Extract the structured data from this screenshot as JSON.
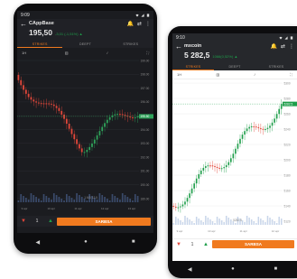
{
  "phones": [
    {
      "id": "left",
      "status_time": "9:09",
      "instrument": "CAppBase",
      "price": "195,50",
      "change": "-3,01 (-1,51%) ▲",
      "tabs": [
        "STRIKES",
        "DEEPT",
        "STRIKES"
      ],
      "toolbar": {
        "interval": "1H",
        "candles_icon": "candles-icon",
        "draw_icon": "pen-icon",
        "fullscreen_icon": "expand-icon"
      },
      "quantity": "1",
      "sell_label": "SARBSA",
      "chart_annotation": "1 MD 12.5",
      "last_price_label": "195.50",
      "axis_labels": [
        "199.00",
        "198.00",
        "197.00",
        "196.00",
        "195.00",
        "194.00",
        "193.00",
        "192.00",
        "191.00",
        "190.00",
        "189.00"
      ],
      "x_labels": [
        "9 apr",
        "10 apr",
        "11 apr",
        "12 apr",
        "13 apr"
      ],
      "colors": {
        "up": "#2fa35a",
        "down": "#e2473a",
        "accent": "#f07a1f",
        "price_line": "#2fa35a"
      }
    },
    {
      "id": "right",
      "status_time": "9:10",
      "instrument": "mxcoin",
      "price": "5 282,5",
      "change": "1066(0,52%) ▲",
      "tabs": [
        "STRIKES",
        "DEEPT",
        "STRIKES"
      ],
      "toolbar": {
        "interval": "1H",
        "candles_icon": "candles-icon",
        "draw_icon": "pen-icon",
        "fullscreen_icon": "expand-icon"
      },
      "quantity": "1",
      "sell_label": "SARBSA",
      "chart_annotation": "5282.5",
      "last_price_label": "5282.5",
      "axis_labels": [
        "5300",
        "5280",
        "5260",
        "5240",
        "5220",
        "5200",
        "5180",
        "5160",
        "5140",
        "5120"
      ],
      "x_labels": [
        "9 apr",
        "10 apr",
        "11 apr",
        "12 apr"
      ],
      "colors": {
        "up": "#1e9e4a",
        "down": "#e2473a",
        "accent": "#f07a1f",
        "price_line": "#1e9e4a"
      }
    }
  ]
}
